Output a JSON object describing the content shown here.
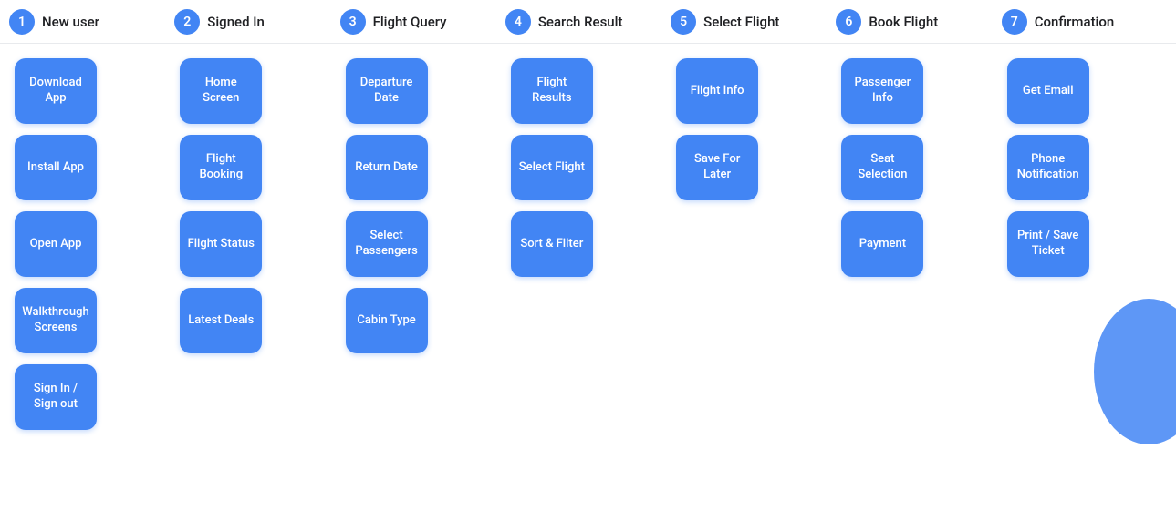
{
  "steps": [
    {
      "num": "1",
      "label": "New user"
    },
    {
      "num": "2",
      "label": "Signed In"
    },
    {
      "num": "3",
      "label": "Flight Query"
    },
    {
      "num": "4",
      "label": "Search Result"
    },
    {
      "num": "5",
      "label": "Select Flight"
    },
    {
      "num": "6",
      "label": "Book Flight"
    },
    {
      "num": "7",
      "label": "Confirmation"
    }
  ],
  "columns": [
    {
      "step": 1,
      "cards": [
        {
          "label": "Download App"
        },
        {
          "label": "Install App"
        },
        {
          "label": "Open App"
        },
        {
          "label": "Walkthrough Screens"
        },
        {
          "label": "Sign In / Sign out"
        }
      ]
    },
    {
      "step": 2,
      "cards": [
        {
          "label": "Home Screen"
        },
        {
          "label": "Flight Booking"
        },
        {
          "label": "Flight Status"
        },
        {
          "label": "Latest Deals"
        }
      ]
    },
    {
      "step": 3,
      "cards": [
        {
          "label": "Departure Date"
        },
        {
          "label": "Return Date"
        },
        {
          "label": "Select Passengers"
        },
        {
          "label": "Cabin Type"
        }
      ]
    },
    {
      "step": 4,
      "cards": [
        {
          "label": "Flight Results"
        },
        {
          "label": "Select Flight"
        },
        {
          "label": "Sort & Filter"
        }
      ]
    },
    {
      "step": 5,
      "cards": [
        {
          "label": "Flight Info"
        },
        {
          "label": "Save For Later"
        }
      ]
    },
    {
      "step": 6,
      "cards": [
        {
          "label": "Passenger Info"
        },
        {
          "label": "Seat Selection"
        },
        {
          "label": "Payment"
        }
      ]
    },
    {
      "step": 7,
      "cards": [
        {
          "label": "Get Email"
        },
        {
          "label": "Phone Notification"
        },
        {
          "label": "Print / Save Ticket"
        }
      ]
    }
  ]
}
